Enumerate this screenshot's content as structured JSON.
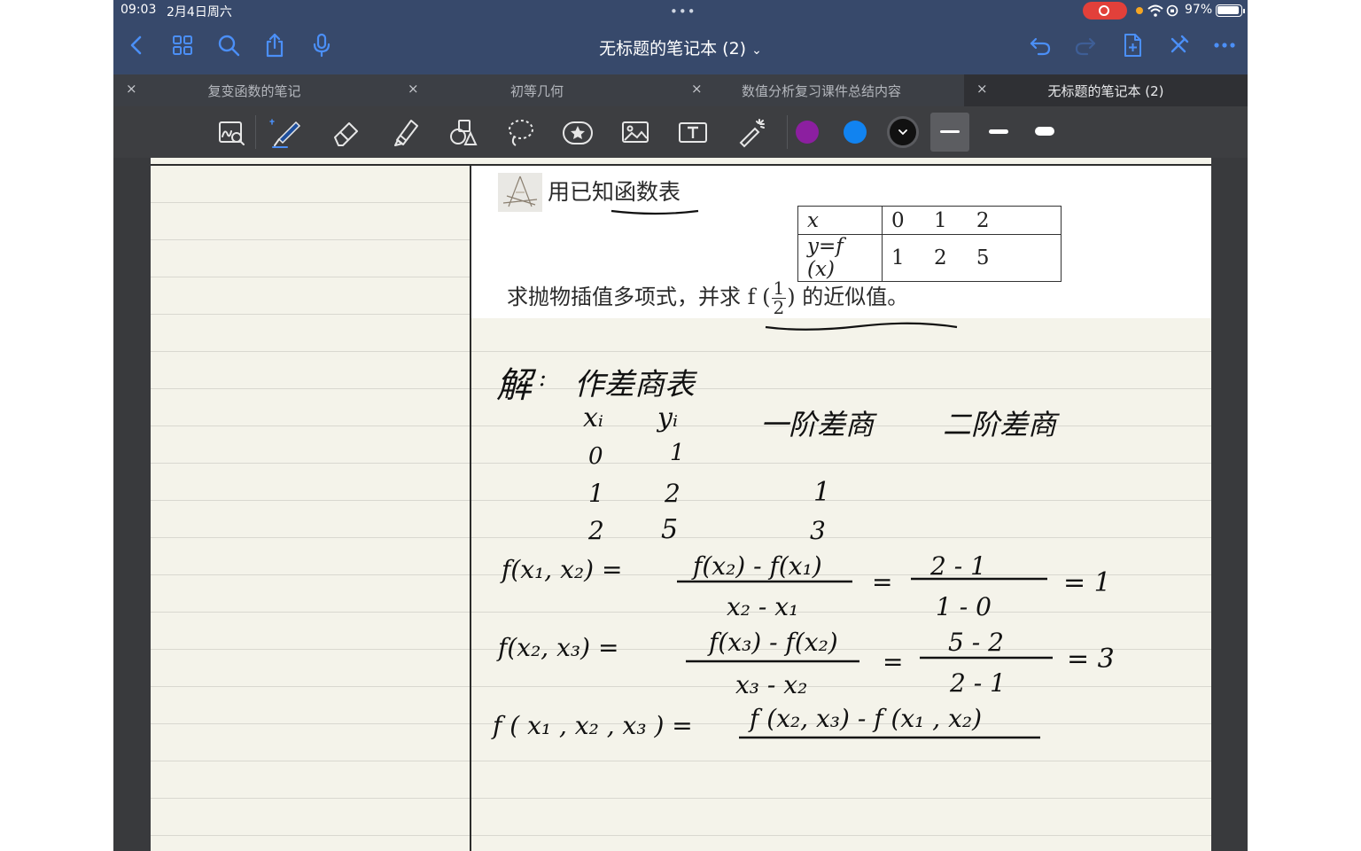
{
  "status_bar": {
    "time": "09:03",
    "date": "2月4日周六",
    "battery": "97%",
    "grabber": "•••"
  },
  "header": {
    "title": "无标题的笔记本 (2)",
    "title_caret": "⌄"
  },
  "tabs": [
    {
      "label": "复变函数的笔记",
      "close": "×"
    },
    {
      "label": "初等几何",
      "close": "×"
    },
    {
      "label": "数值分析复习课件总结内容",
      "close": "×"
    },
    {
      "label": "无标题的笔记本 (2)",
      "close": "×"
    }
  ],
  "toolbar": {
    "tools": [
      "zoom-window-icon",
      "pen-icon",
      "eraser-icon",
      "highlighter-icon",
      "shapes-icon",
      "lasso-icon",
      "sticker-icon",
      "image-icon",
      "text-icon",
      "laser-pointer-icon"
    ],
    "colors": {
      "purple": "#8c1fa0",
      "blue": "#1183f0",
      "black": "#111111"
    }
  },
  "page": {
    "problem": {
      "title": "用已知函数表",
      "table": {
        "row1_head": "x",
        "row1_values": "0 1 2",
        "row2_head": "y=f (x)",
        "row2_values": "1 2 5"
      },
      "question_prefix": "求抛物插值多项式，并求 f (",
      "fraction_num": "1",
      "fraction_den": "2",
      "question_suffix": ") 的近似值。"
    },
    "handwriting": {
      "solution_label": "解",
      "solution_colon": ":",
      "step1": "作差商表",
      "col_x": "xᵢ",
      "col_y": "yᵢ",
      "col_first": "一阶差商",
      "col_second": "二阶差商",
      "rows": [
        {
          "x": "0",
          "y": "1",
          "d1": ""
        },
        {
          "x": "1",
          "y": "2",
          "d1": "1"
        },
        {
          "x": "2",
          "y": "5",
          "d1": "3"
        }
      ],
      "eq1_lhs": "f(x₁, x₂) =",
      "eq1_num": "f(x₂) - f(x₁)",
      "eq1_den": "x₂ - x₁",
      "eq1_eq": "=",
      "eq1_num2": "2 - 1",
      "eq1_den2": "1 - 0",
      "eq1_result": "= 1",
      "eq2_lhs": "f(x₂, x₃) =",
      "eq2_num": "f(x₃) - f(x₂)",
      "eq2_den": "x₃ - x₂",
      "eq2_eq": "=",
      "eq2_num2": "5 - 2",
      "eq2_den2": "2 - 1",
      "eq2_result": "= 3",
      "eq3_lhs": "f ( x₁ , x₂ , x₃ ) =",
      "eq3_num": "f (x₂, x₃) - f (x₁ , x₂)"
    }
  }
}
